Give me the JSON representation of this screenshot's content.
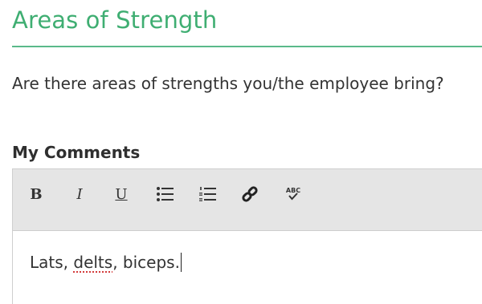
{
  "section": {
    "title": "Areas of Strength",
    "question": "Are there areas of strengths you/the employee bring?"
  },
  "comments": {
    "label": "My Comments",
    "toolbar": {
      "bold_label": "B",
      "italic_label": "I",
      "underline_label": "U",
      "spellcheck_label": "ABC"
    },
    "content_before": "Lats, ",
    "content_misspelled": "delts",
    "content_after": ", biceps."
  },
  "colors": {
    "heading": "#3fae72",
    "rule": "#5ab98a",
    "toolbar_bg": "#e5e5e5"
  },
  "icons": {
    "bullets": "bulleted-list-icon",
    "numbers": "numbered-list-icon",
    "link": "link-icon",
    "spell": "spellcheck-icon"
  }
}
